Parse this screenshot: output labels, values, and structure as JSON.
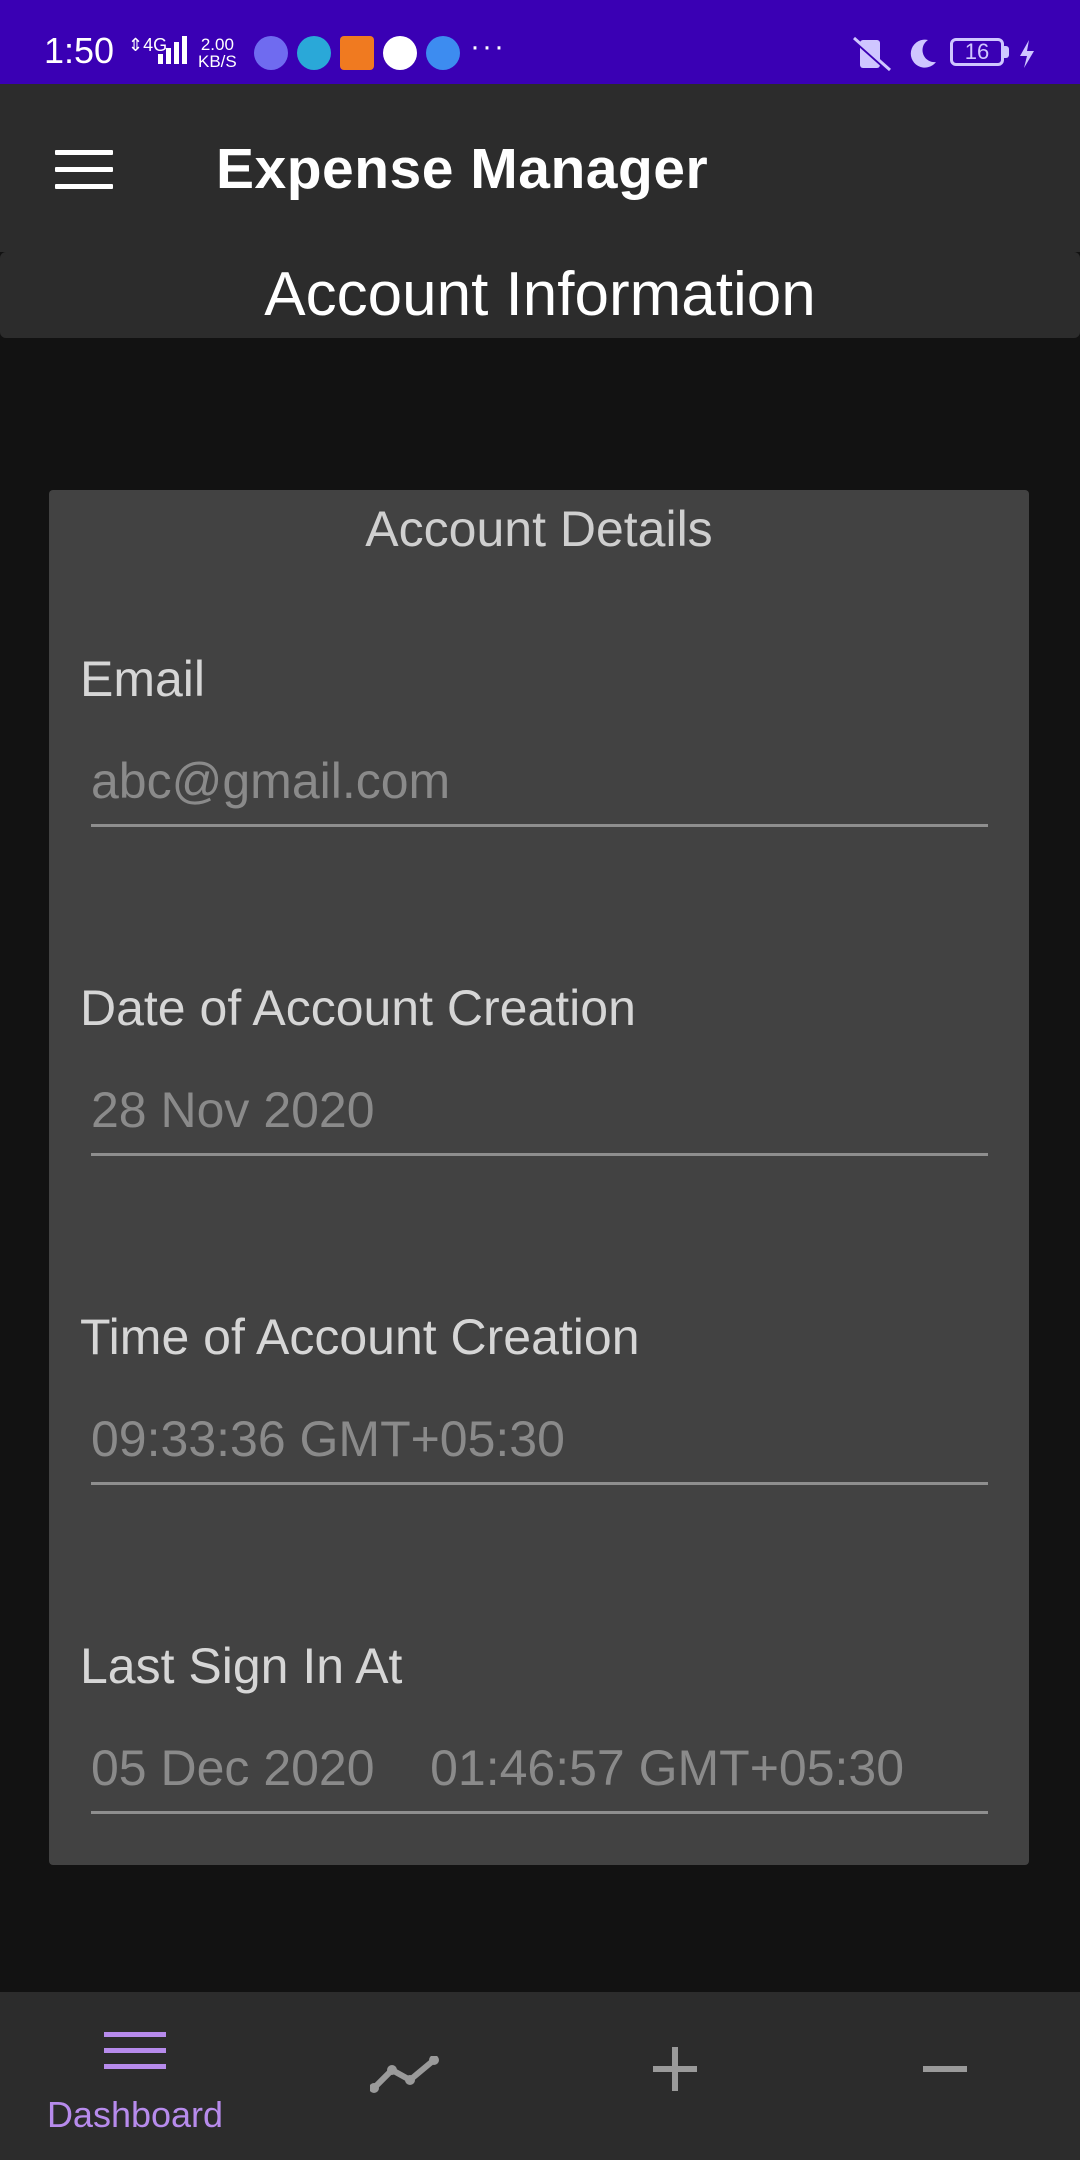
{
  "status_bar": {
    "time": "1:50",
    "network": "4G",
    "speed_value": "2.00",
    "speed_unit": "KB/S",
    "more": "···",
    "battery": "16"
  },
  "app_bar": {
    "title": "Expense Manager"
  },
  "section": {
    "title": "Account Information"
  },
  "card": {
    "title": "Account Details",
    "fields": [
      {
        "label": "Email",
        "value": "abc@gmail.com"
      },
      {
        "label": "Date of Account Creation",
        "value": "28 Nov 2020"
      },
      {
        "label": "Time of Account Creation",
        "value": "09:33:36 GMT+05:30"
      },
      {
        "label": "Last Sign In At",
        "value": "05 Dec 2020    01:46:57 GMT+05:30"
      }
    ]
  },
  "bottom_nav": {
    "items": [
      {
        "label": "Dashboard",
        "icon": "list-icon",
        "active": true
      },
      {
        "label": "",
        "icon": "trend-icon",
        "active": false
      },
      {
        "label": "",
        "icon": "plus-icon",
        "active": false
      },
      {
        "label": "",
        "icon": "minus-icon",
        "active": false
      }
    ]
  },
  "colors": {
    "status_bar": "#3a00b4",
    "app_bar": "#2c2c2c",
    "background": "#121212",
    "card": "#424242",
    "accent": "#b78bec"
  }
}
